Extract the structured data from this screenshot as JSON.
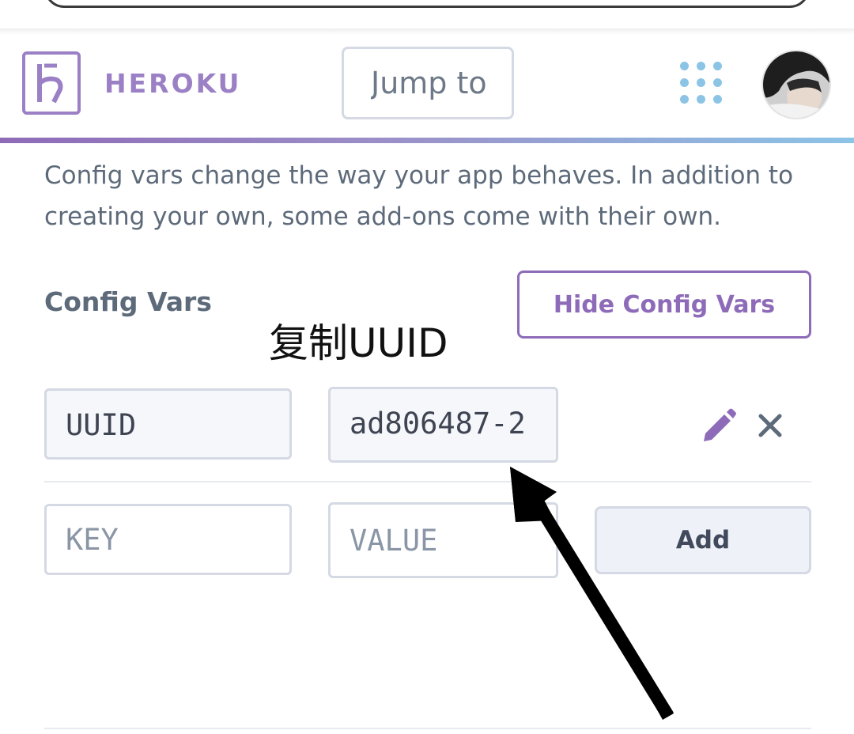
{
  "header": {
    "brand": "HEROKU",
    "jump_placeholder": "Jump to"
  },
  "config": {
    "intro": "Config vars change the way your app behaves. In addition to creating your own, some add-ons come with their own.",
    "section_title": "Config Vars",
    "hide_button": "Hide Config Vars",
    "vars": [
      {
        "key": "UUID",
        "value": "ad806487-2"
      }
    ],
    "new_key_placeholder": "KEY",
    "new_value_placeholder": "VALUE",
    "add_button": "Add"
  },
  "annotation": {
    "text": "复制UUID"
  },
  "icons": {
    "logo": "heroku-logo-icon",
    "apps": "apps-grid-icon",
    "edit": "pencil-icon",
    "delete": "close-icon"
  },
  "colors": {
    "brand_purple": "#9b80c6",
    "accent_purple": "#8e6bb8",
    "apps_blue": "#8cc4e6",
    "text_gray": "#5d6a7a"
  }
}
